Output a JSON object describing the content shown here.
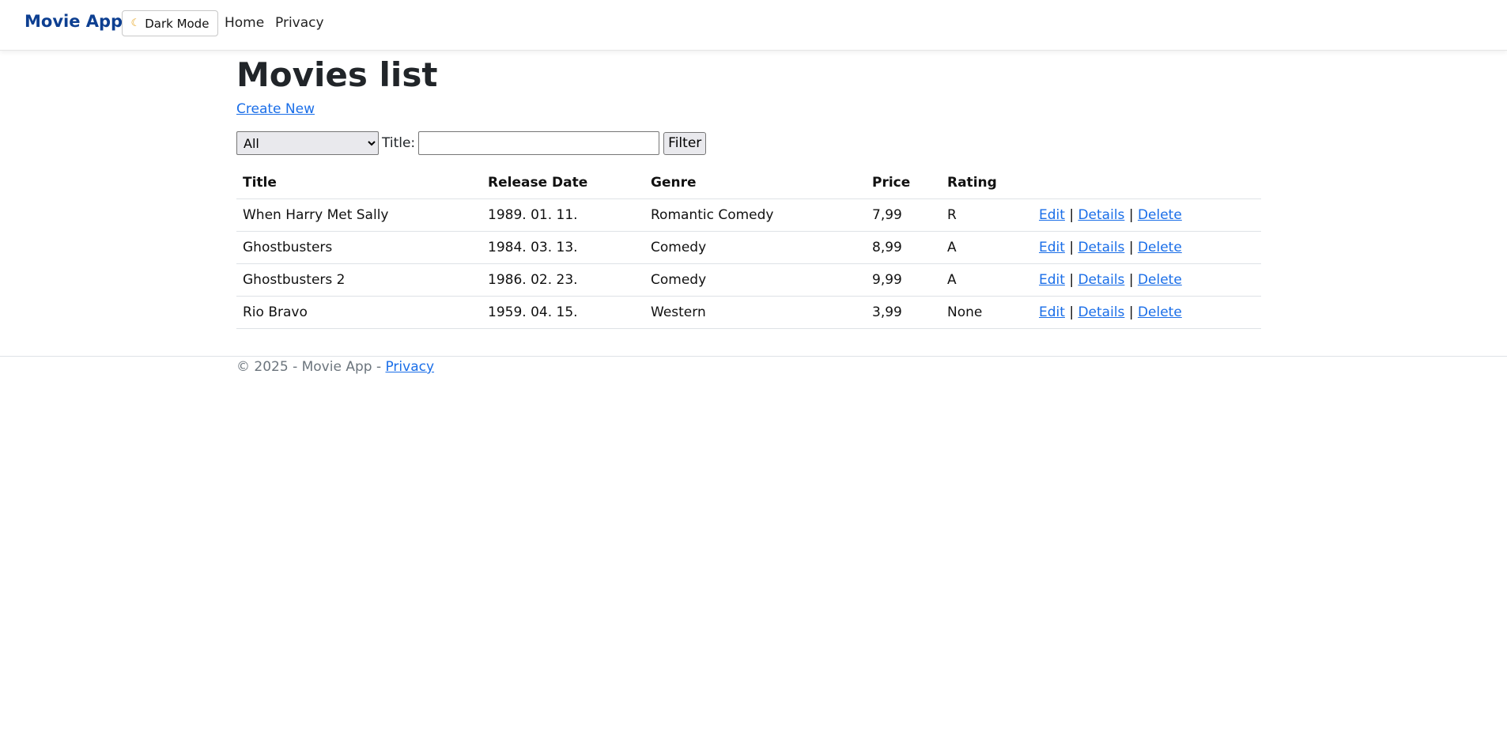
{
  "navbar": {
    "brand": "Movie App",
    "dark_mode_label": "Dark Mode",
    "dark_mode_icon": "moon-icon",
    "links": [
      "Home",
      "Privacy"
    ]
  },
  "main": {
    "title": "Movies list",
    "create_link": "Create New",
    "filter": {
      "genre_selected": "All",
      "title_label": "Title:",
      "title_value": "",
      "button_label": "Filter"
    },
    "table": {
      "headers": [
        "Title",
        "Release Date",
        "Genre",
        "Price",
        "Rating",
        ""
      ],
      "rows": [
        {
          "title": "When Harry Met Sally",
          "release_date": "1989. 01. 11.",
          "genre": "Romantic Comedy",
          "price": "7,99",
          "rating": "R"
        },
        {
          "title": "Ghostbusters",
          "release_date": "1984. 03. 13.",
          "genre": "Comedy",
          "price": "8,99",
          "rating": "A"
        },
        {
          "title": "Ghostbusters 2",
          "release_date": "1986. 02. 23.",
          "genre": "Comedy",
          "price": "9,99",
          "rating": "A"
        },
        {
          "title": "Rio Bravo",
          "release_date": "1959. 04. 15.",
          "genre": "Western",
          "price": "3,99",
          "rating": "None"
        }
      ],
      "actions": {
        "edit": "Edit",
        "details": "Details",
        "delete": "Delete",
        "separator": "|"
      }
    }
  },
  "footer": {
    "text": "© 2025 - Movie App -",
    "link": "Privacy"
  },
  "colors": {
    "brand": "#0d3f91",
    "link": "#1a6ee8",
    "muted": "#6c757d"
  }
}
